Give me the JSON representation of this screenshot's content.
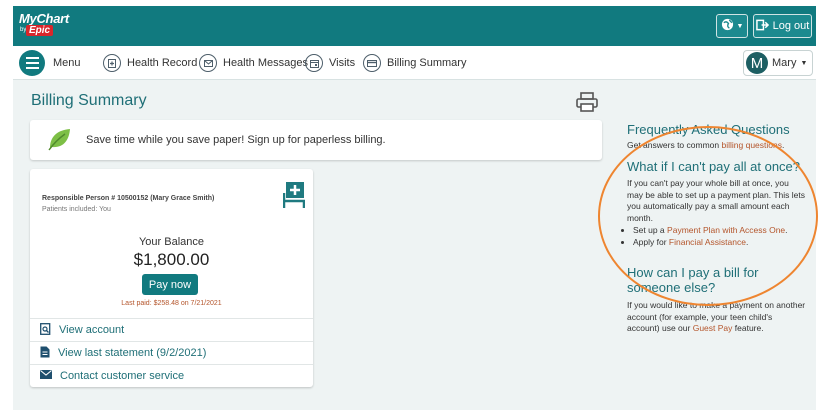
{
  "header": {
    "logo": {
      "mychart": "MyChart",
      "by": "by",
      "epic": "Epic"
    },
    "logout_label": "Log out"
  },
  "nav": {
    "menu_label": "Menu",
    "items": [
      {
        "label": "Health Record",
        "icon": "health-record-icon"
      },
      {
        "label": "Health Messages",
        "icon": "envelope-icon"
      },
      {
        "label": "Visits",
        "icon": "calendar-icon"
      },
      {
        "label": "Billing Summary",
        "icon": "credit-card-icon"
      }
    ],
    "user": {
      "initial": "M",
      "name": "Mary"
    }
  },
  "main": {
    "title": "Billing Summary",
    "promo_text": "Save time while you save paper! Sign up for paperless billing.",
    "account": {
      "responsible": "Responsible Person # 10500152",
      "name": "(Mary Grace Smith)",
      "patients": "Patients included: You",
      "balance_label": "Your Balance",
      "balance": "$1,800.00",
      "pay_label": "Pay now",
      "last_paid": "Last paid: $258.48 on 7/21/2021",
      "links": [
        {
          "label": "View account",
          "icon": "search-document-icon"
        },
        {
          "label": "View last statement (9/2/2021)",
          "icon": "document-icon"
        },
        {
          "label": "Contact customer service",
          "icon": "envelope-icon"
        }
      ]
    }
  },
  "sidebar": {
    "faq_title": "Frequently Asked Questions",
    "faq_text": "Get answers to common",
    "faq_link": "billing questions",
    "faq_end": ".",
    "q1_title": "What if I can't pay all at once?",
    "q1_text": "If you can't pay your whole bill at once, you may be able to set up a payment plan. This lets you automatically pay a small amount each month.",
    "q1_items": [
      {
        "pre": "Set up a",
        "link": "Payment Plan with Access One",
        "post": "."
      },
      {
        "pre": "Apply for",
        "link": "Financial Assistance",
        "post": "."
      }
    ],
    "q2_title": "How can I pay a bill for someone else?",
    "q2_text": "If you would like to make a payment on another account (for example, your teen child's account) use our",
    "q2_link": "Guest Pay",
    "q2_end": "feature."
  },
  "colors": {
    "teal": "#117a7f",
    "link": "#b4552b",
    "highlight": "#ee8530"
  }
}
